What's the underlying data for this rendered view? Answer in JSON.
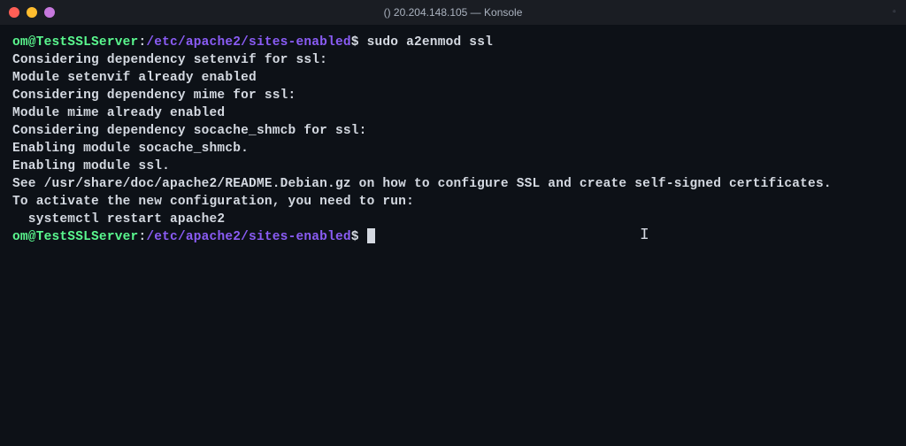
{
  "window": {
    "title": "() 20.204.148.105 — Konsole"
  },
  "prompt": {
    "user_host": "om@TestSSLServer",
    "colon": ":",
    "path": "/etc/apache2/sites-enabled",
    "symbol": "$"
  },
  "command1": "sudo a2enmod ssl",
  "output": {
    "l1": "Considering dependency setenvif for ssl:",
    "l2": "Module setenvif already enabled",
    "l3": "Considering dependency mime for ssl:",
    "l4": "Module mime already enabled",
    "l5": "Considering dependency socache_shmcb for ssl:",
    "l6": "Enabling module socache_shmcb.",
    "l7": "Enabling module ssl.",
    "l8": "See /usr/share/doc/apache2/README.Debian.gz on how to configure SSL and create self-signed certificates.",
    "l9": "To activate the new configuration, you need to run:",
    "l10": "  systemctl restart apache2"
  }
}
